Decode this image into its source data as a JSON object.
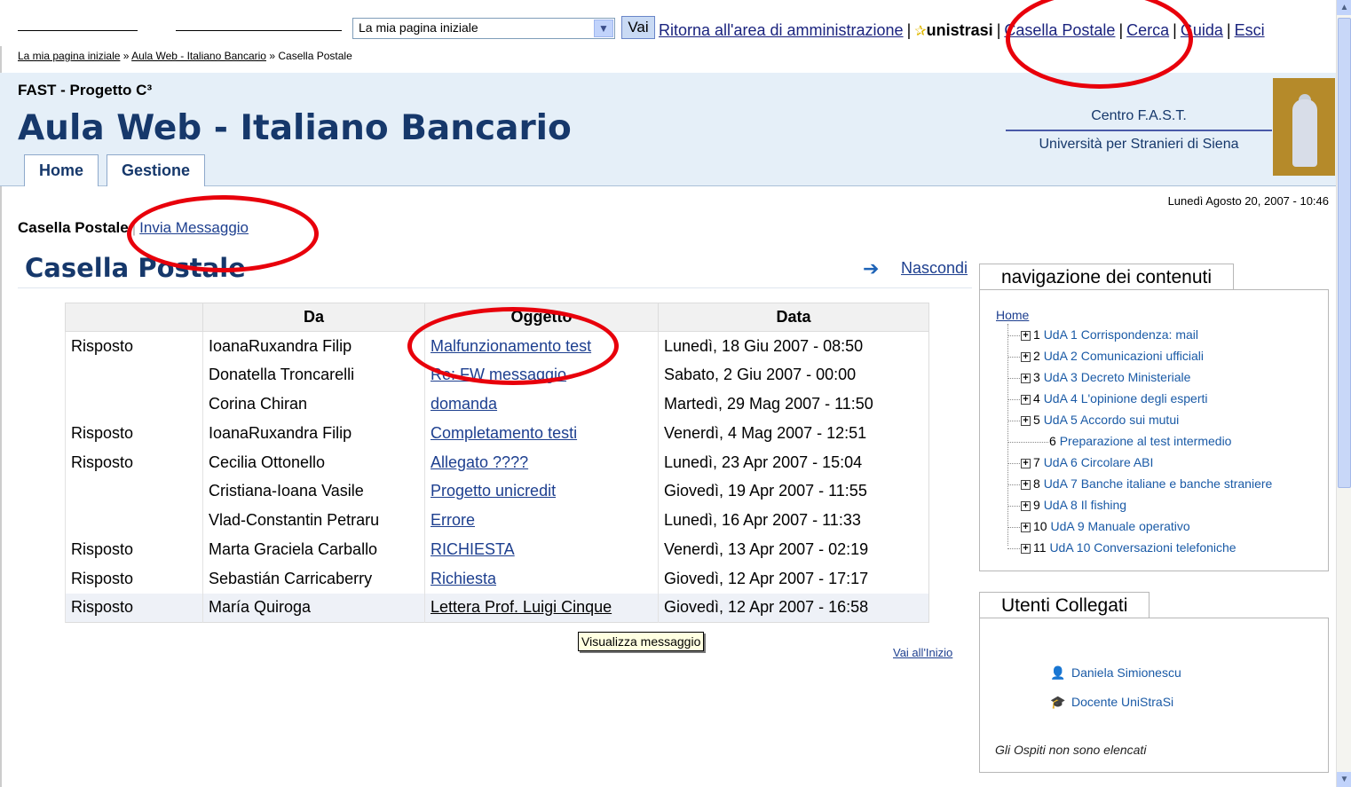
{
  "topbar": {
    "jump_select_value": "La mia pagina iniziale",
    "go_button": "Vai",
    "links": {
      "admin": "Ritorna all'area di amministrazione",
      "user": "unistrasi",
      "mailbox": "Casella Postale",
      "search": "Cerca",
      "help": "Guida",
      "logout": "Esci"
    },
    "separator": "|"
  },
  "breadcrumb": {
    "home": "La mia pagina iniziale",
    "course": "Aula Web - Italiano Bancario",
    "current": "Casella Postale",
    "sep": "»"
  },
  "header": {
    "org": "FAST - Progetto C³",
    "site_title": "Aula Web - Italiano Bancario",
    "tabs": [
      "Home",
      "Gestione"
    ],
    "institution_line1": "Centro F.A.S.T.",
    "institution_line2": "Università per Stranieri di Siena"
  },
  "datetime": "Lunedì Agosto 20, 2007 - 10:46",
  "subnav": {
    "current": "Casella Postale",
    "sep": "|",
    "send": "Invia Messaggio"
  },
  "page": {
    "heading": "Casella Postale",
    "hide_link": "Nascondi",
    "to_top": "Vai all'Inizio"
  },
  "mail": {
    "headers": [
      "",
      "Da",
      "Oggetto",
      "Data"
    ],
    "rows": [
      {
        "status": "Risposto",
        "from": "IoanaRuxandra Filip",
        "subject": "Malfunzionamento test",
        "date": "Lunedì, 18 Giu 2007 - 08:50"
      },
      {
        "status": "",
        "from": "Donatella Troncarelli",
        "subject": "Re: FW messaggio",
        "date": "Sabato, 2 Giu 2007 - 00:00"
      },
      {
        "status": "",
        "from": "Corina Chiran",
        "subject": "domanda",
        "date": "Martedì, 29 Mag 2007 - 11:50"
      },
      {
        "status": "Risposto",
        "from": "IoanaRuxandra Filip",
        "subject": "Completamento testi",
        "date": "Venerdì, 4 Mag 2007 - 12:51"
      },
      {
        "status": "Risposto",
        "from": "Cecilia Ottonello",
        "subject": "Allegato ????",
        "date": "Lunedì, 23 Apr 2007 - 15:04"
      },
      {
        "status": "",
        "from": "Cristiana-Ioana Vasile",
        "subject": "Progetto unicredit",
        "date": "Giovedì, 19 Apr 2007 - 11:55"
      },
      {
        "status": "",
        "from": "Vlad-Constantin Petraru",
        "subject": "Errore",
        "date": "Lunedì, 16 Apr 2007 - 11:33"
      },
      {
        "status": "Risposto",
        "from": "Marta Graciela Carballo",
        "subject": "RICHIESTA",
        "date": "Venerdì, 13 Apr 2007 - 02:19"
      },
      {
        "status": "Risposto",
        "from": "Sebastián Carricaberry",
        "subject": "Richiesta",
        "date": "Giovedì, 12 Apr 2007 - 17:17"
      },
      {
        "status": "Risposto",
        "from": "María Quiroga",
        "subject": "Lettera Prof. Luigi Cinque",
        "date": "Giovedì, 12 Apr 2007 - 16:58"
      }
    ]
  },
  "tooltip": "Visualizza messaggio",
  "content_nav": {
    "title": "navigazione dei contenuti",
    "home": "Home",
    "items": [
      {
        "num": "1",
        "label": "UdA 1 Corrispondenza: mail",
        "expandable": true
      },
      {
        "num": "2",
        "label": "UdA 2 Comunicazioni ufficiali",
        "expandable": true
      },
      {
        "num": "3",
        "label": "UdA 3 Decreto Ministeriale",
        "expandable": true
      },
      {
        "num": "4",
        "label": "UdA 4 L'opinione degli esperti",
        "expandable": true
      },
      {
        "num": "5",
        "label": "UdA 5 Accordo sui mutui",
        "expandable": true
      },
      {
        "num": "6",
        "label": "Preparazione al test intermedio",
        "expandable": false
      },
      {
        "num": "7",
        "label": "UdA 6 Circolare ABI",
        "expandable": true
      },
      {
        "num": "8",
        "label": "UdA 7 Banche italiane e banche straniere",
        "expandable": true
      },
      {
        "num": "9",
        "label": "UdA 8 Il fishing",
        "expandable": true
      },
      {
        "num": "10",
        "label": "UdA 9 Manuale operativo",
        "expandable": true
      },
      {
        "num": "11",
        "label": "UdA 10 Conversazioni telefoniche",
        "expandable": true
      }
    ]
  },
  "online_users": {
    "title": "Utenti Collegati",
    "users": [
      {
        "name": "Daniela Simionescu",
        "icon": "user-icon"
      },
      {
        "name": "Docente UniStraSi",
        "icon": "graduation-cap-icon"
      }
    ],
    "guests_note": "Gli Ospiti non sono elencati"
  },
  "colors": {
    "accent": "#16386b",
    "link": "#1a5aa6",
    "header_bg": "#e5eff8",
    "annotation": "#e8000b"
  }
}
